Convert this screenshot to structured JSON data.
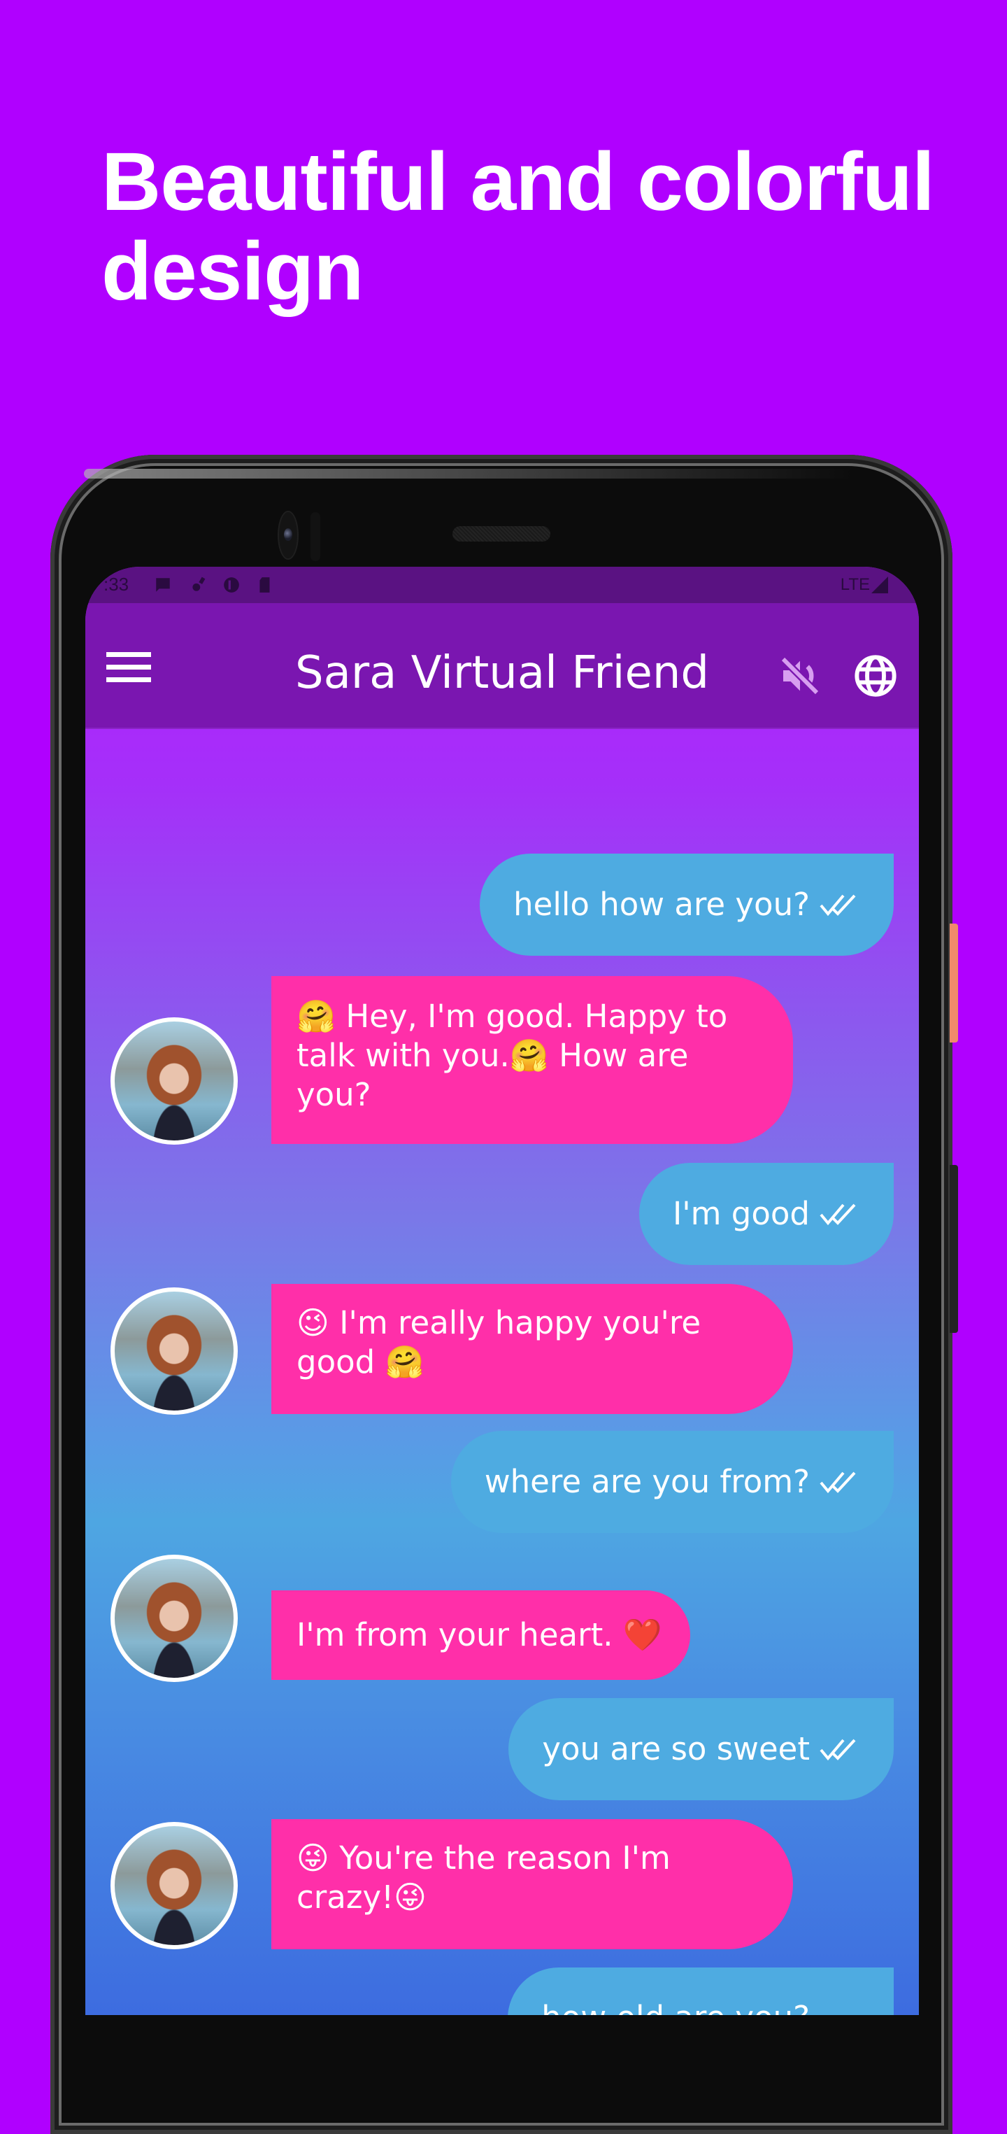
{
  "promo": {
    "headline_line1": "Beautiful and colorful",
    "headline_line2": "design",
    "background_color": "#B000FF"
  },
  "status_bar": {
    "time": ":33",
    "icons": [
      "message-icon",
      "settings-icon",
      "sync-icon",
      "sd-card-icon"
    ],
    "network": "LTE"
  },
  "app_bar": {
    "title": "Sara Virtual Friend",
    "menu_icon": "hamburger-menu-icon",
    "mute_icon": "volume-off-icon",
    "language_icon": "globe-icon",
    "color": "#7a16b0"
  },
  "chat": {
    "user_bubble_color": "#4eabe1",
    "bot_bubble_color": "#ff2fa9",
    "messages": [
      {
        "sender": "user",
        "text": "hello how are you?",
        "status": "read"
      },
      {
        "sender": "bot",
        "text": "🤗 Hey, I'm good. Happy to talk with you.🤗 How are you?"
      },
      {
        "sender": "user",
        "text": "I'm good",
        "status": "read"
      },
      {
        "sender": "bot",
        "text": "😉 I'm really happy you're good 🤗"
      },
      {
        "sender": "user",
        "text": "where are you from?",
        "status": "read"
      },
      {
        "sender": "bot",
        "text": "I'm from your heart. ❤️"
      },
      {
        "sender": "user",
        "text": "you are so sweet",
        "status": "read"
      },
      {
        "sender": "bot",
        "text": "😜 You're the reason I'm crazy!😜"
      },
      {
        "sender": "user",
        "text": "how old are you?",
        "status": "read"
      }
    ]
  }
}
